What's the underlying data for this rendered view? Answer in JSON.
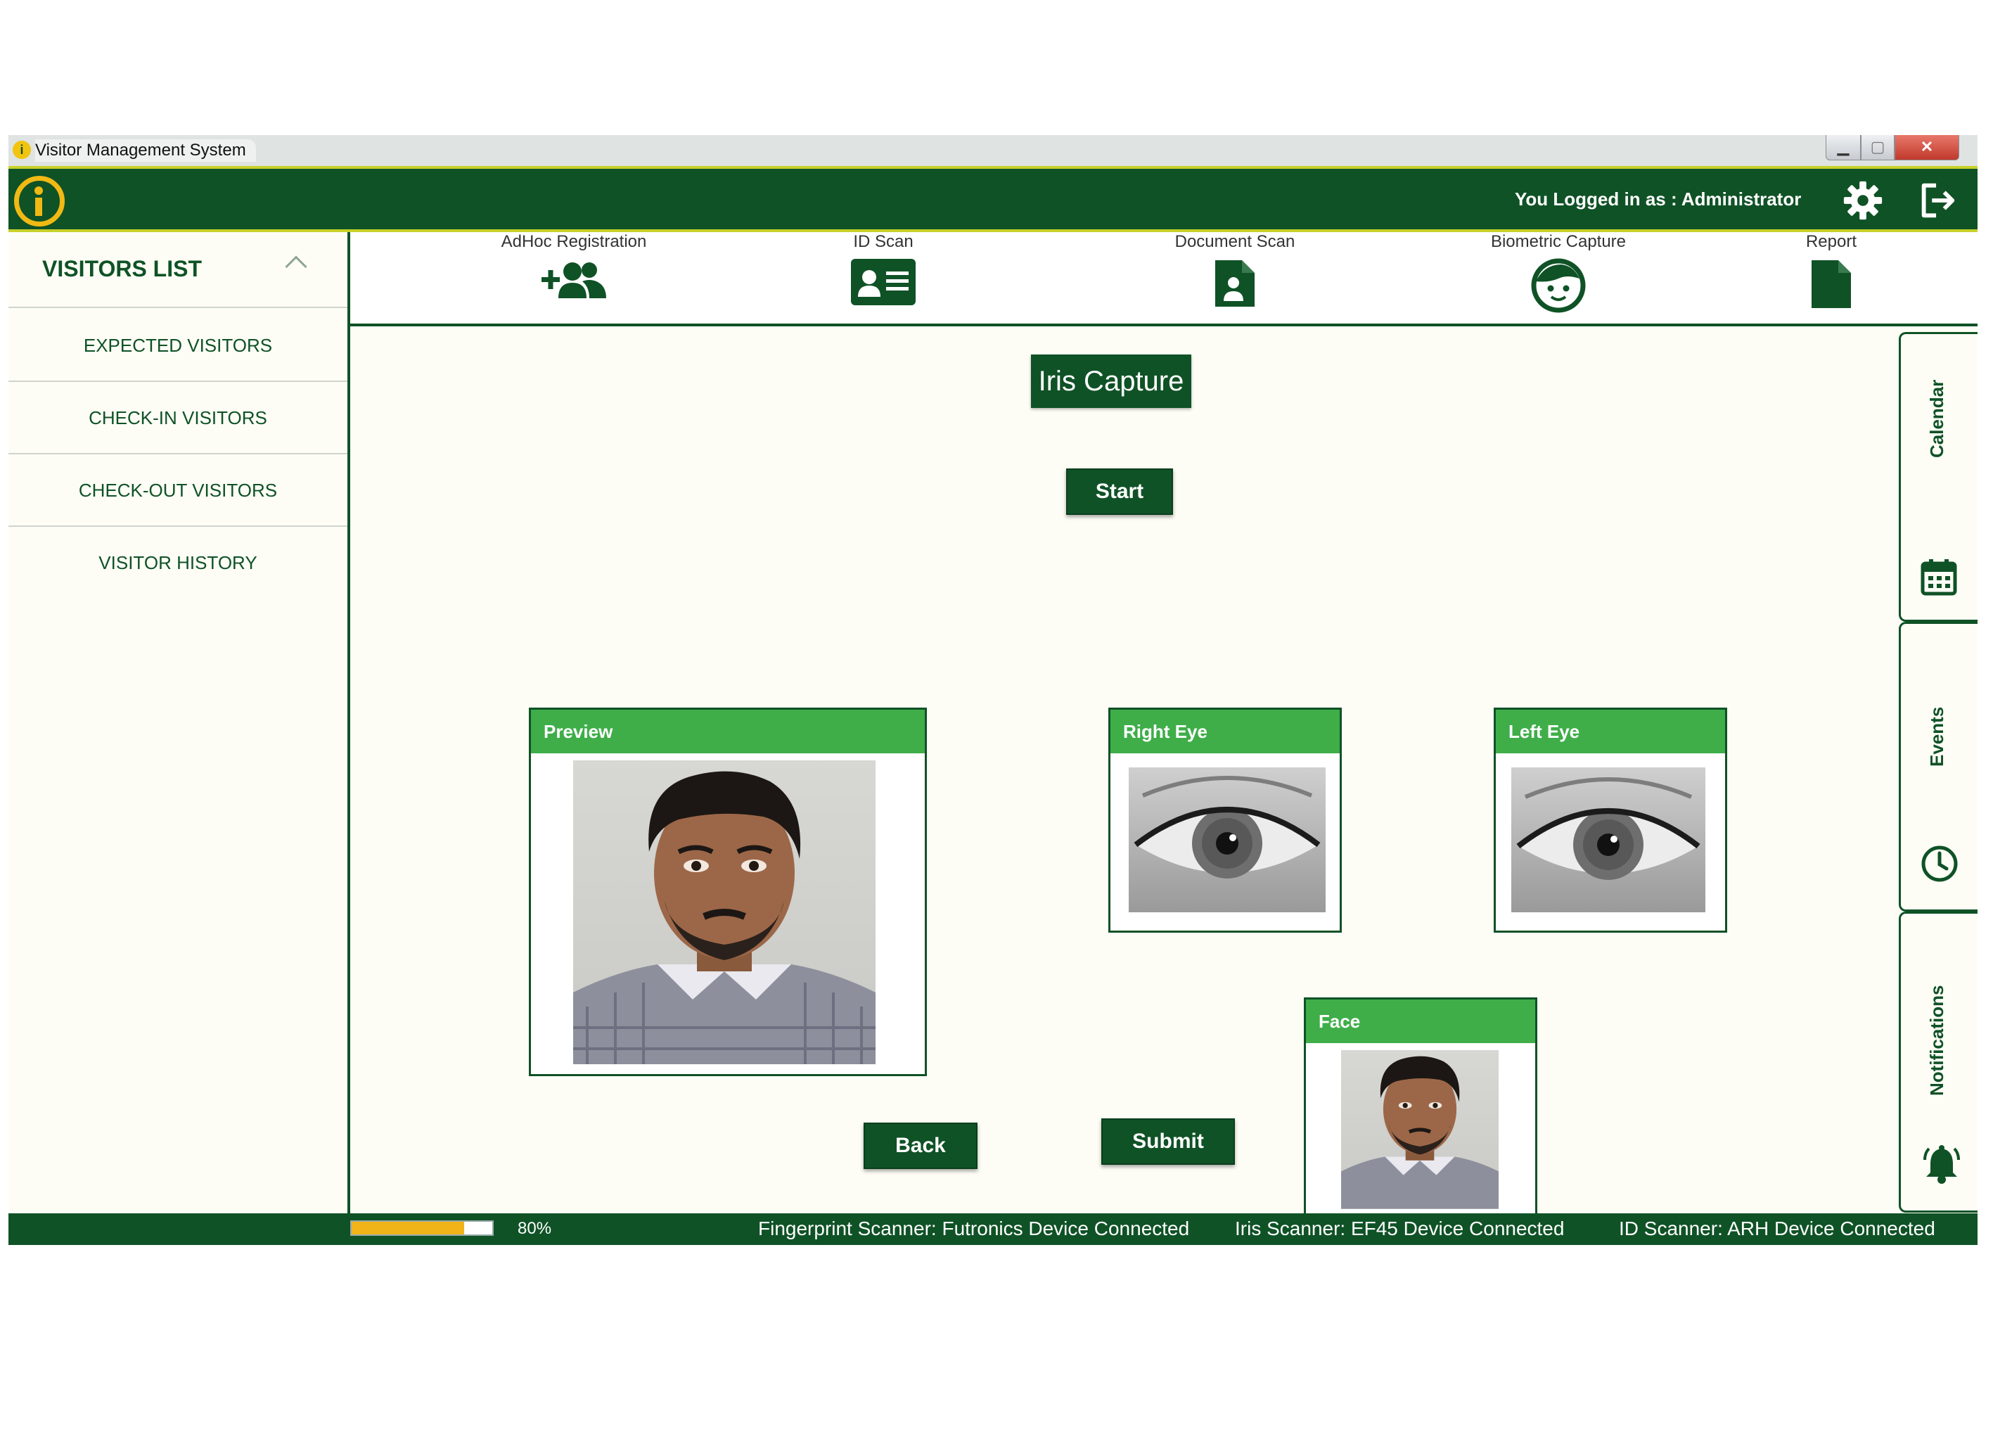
{
  "window": {
    "title": "Visitor Management System",
    "min": "▁",
    "max": "▢",
    "close": "✕"
  },
  "header": {
    "logged_in_text": "You Logged in as : Administrator",
    "settings_icon": "gear-icon",
    "logout_icon": "logout-icon"
  },
  "sidebar": {
    "title": "VISITORS LIST",
    "items": [
      {
        "label": "EXPECTED VISITORS"
      },
      {
        "label": "CHECK-IN VISITORS"
      },
      {
        "label": "CHECK-OUT VISITORS"
      },
      {
        "label": "VISITOR HISTORY"
      }
    ]
  },
  "toolbar": {
    "items": [
      {
        "label": "AdHoc Registration",
        "icon": "add-user-icon"
      },
      {
        "label": "ID Scan",
        "icon": "id-card-icon"
      },
      {
        "label": "Document Scan",
        "icon": "document-user-icon"
      },
      {
        "label": "Biometric Capture",
        "icon": "face-icon"
      },
      {
        "label": "Report",
        "icon": "report-icon"
      }
    ]
  },
  "main": {
    "title": "Iris Capture",
    "start_label": "Start",
    "back_label": "Back",
    "submit_label": "Submit",
    "panels": {
      "preview": "Preview",
      "right_eye": "Right Eye",
      "left_eye": "Left Eye",
      "face": "Face"
    }
  },
  "right_tabs": {
    "calendar": "Calendar",
    "events": "Events",
    "notifications": "Notifications"
  },
  "status": {
    "progress_value": 0.8,
    "progress_text": "80%",
    "fingerprint": "Fingerprint Scanner: Futronics Device Connected",
    "iris": "Iris Scanner: EF45 Device Connected",
    "id_scanner": "ID Scanner: ARH Device Connected"
  },
  "colors": {
    "primary": "#0f5226",
    "accent_green": "#3fae49",
    "accent_yellow": "#f1b914",
    "header_border": "#c8d12a"
  }
}
